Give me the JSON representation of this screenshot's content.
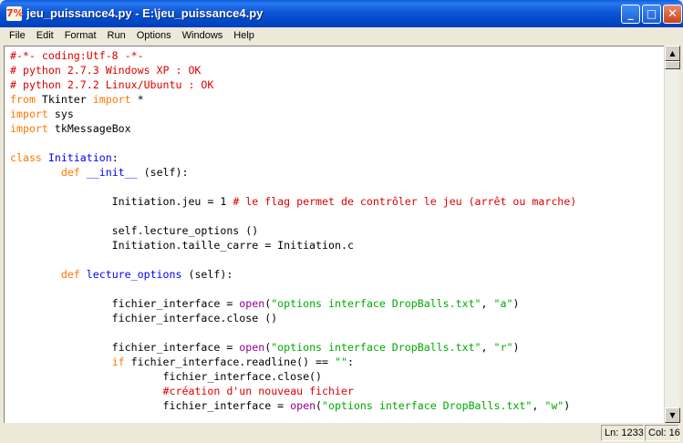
{
  "window": {
    "title": "jeu_puissance4.py - E:\\jeu_puissance4.py",
    "icon": "idle-icon",
    "minimize_label": "_",
    "maximize_label": "□",
    "close_label": "✕"
  },
  "menu": {
    "items": [
      "File",
      "Edit",
      "Format",
      "Run",
      "Options",
      "Windows",
      "Help"
    ]
  },
  "editor": {
    "lines": [
      [
        {
          "t": "#-*- coding:Utf-8 -*-",
          "c": "comment"
        }
      ],
      [
        {
          "t": "# python 2.7.3 Windows XP : OK",
          "c": "comment"
        }
      ],
      [
        {
          "t": "# python 2.7.2 Linux/Ubuntu : OK",
          "c": "comment"
        }
      ],
      [
        {
          "t": "from",
          "c": "kw"
        },
        {
          "t": " Tkinter ",
          "c": ""
        },
        {
          "t": "import",
          "c": "kw"
        },
        {
          "t": " *",
          "c": ""
        }
      ],
      [
        {
          "t": "import",
          "c": "kw"
        },
        {
          "t": " sys",
          "c": ""
        }
      ],
      [
        {
          "t": "import",
          "c": "kw"
        },
        {
          "t": " tkMessageBox",
          "c": ""
        }
      ],
      [],
      [
        {
          "t": "class",
          "c": "kw"
        },
        {
          "t": " ",
          "c": ""
        },
        {
          "t": "Initiation",
          "c": "def"
        },
        {
          "t": ":",
          "c": ""
        }
      ],
      [
        {
          "t": "        ",
          "c": ""
        },
        {
          "t": "def",
          "c": "kw"
        },
        {
          "t": " ",
          "c": ""
        },
        {
          "t": "__init__",
          "c": "def"
        },
        {
          "t": " (self):",
          "c": ""
        }
      ],
      [],
      [
        {
          "t": "                Initiation.jeu = 1 ",
          "c": ""
        },
        {
          "t": "# le flag permet de contrôler le jeu (arrêt ou marche)",
          "c": "comment"
        }
      ],
      [],
      [
        {
          "t": "                self.lecture_options ()",
          "c": ""
        }
      ],
      [
        {
          "t": "                Initiation.taille_carre = Initiation.c",
          "c": ""
        }
      ],
      [],
      [
        {
          "t": "        ",
          "c": ""
        },
        {
          "t": "def",
          "c": "kw"
        },
        {
          "t": " ",
          "c": ""
        },
        {
          "t": "lecture_options",
          "c": "def"
        },
        {
          "t": " (self):",
          "c": ""
        }
      ],
      [],
      [
        {
          "t": "                fichier_interface = ",
          "c": ""
        },
        {
          "t": "open",
          "c": "builtin"
        },
        {
          "t": "(",
          "c": ""
        },
        {
          "t": "\"options interface DropBalls.txt\"",
          "c": "str"
        },
        {
          "t": ", ",
          "c": ""
        },
        {
          "t": "\"a\"",
          "c": "str"
        },
        {
          "t": ")",
          "c": ""
        }
      ],
      [
        {
          "t": "                fichier_interface.close ()",
          "c": ""
        }
      ],
      [],
      [
        {
          "t": "                fichier_interface = ",
          "c": ""
        },
        {
          "t": "open",
          "c": "builtin"
        },
        {
          "t": "(",
          "c": ""
        },
        {
          "t": "\"options interface DropBalls.txt\"",
          "c": "str"
        },
        {
          "t": ", ",
          "c": ""
        },
        {
          "t": "\"r\"",
          "c": "str"
        },
        {
          "t": ")",
          "c": ""
        }
      ],
      [
        {
          "t": "                ",
          "c": ""
        },
        {
          "t": "if",
          "c": "kw"
        },
        {
          "t": " fichier_interface.readline() == ",
          "c": ""
        },
        {
          "t": "\"\"",
          "c": "str"
        },
        {
          "t": ":",
          "c": ""
        }
      ],
      [
        {
          "t": "                        fichier_interface.close()",
          "c": ""
        }
      ],
      [
        {
          "t": "                        ",
          "c": ""
        },
        {
          "t": "#création d'un nouveau fichier",
          "c": "comment"
        }
      ],
      [
        {
          "t": "                        fichier_interface = ",
          "c": ""
        },
        {
          "t": "open",
          "c": "builtin"
        },
        {
          "t": "(",
          "c": ""
        },
        {
          "t": "\"options interface DropBalls.txt\"",
          "c": "str"
        },
        {
          "t": ", ",
          "c": ""
        },
        {
          "t": "\"w\"",
          "c": "str"
        },
        {
          "t": ")",
          "c": ""
        }
      ]
    ]
  },
  "status": {
    "line": "Ln: 1233",
    "col": "Col: 16"
  },
  "colors": {
    "comment": "#dd0000",
    "keyword": "#ff7700",
    "definition": "#0000ff",
    "string": "#00aa00",
    "builtin": "#900090"
  }
}
